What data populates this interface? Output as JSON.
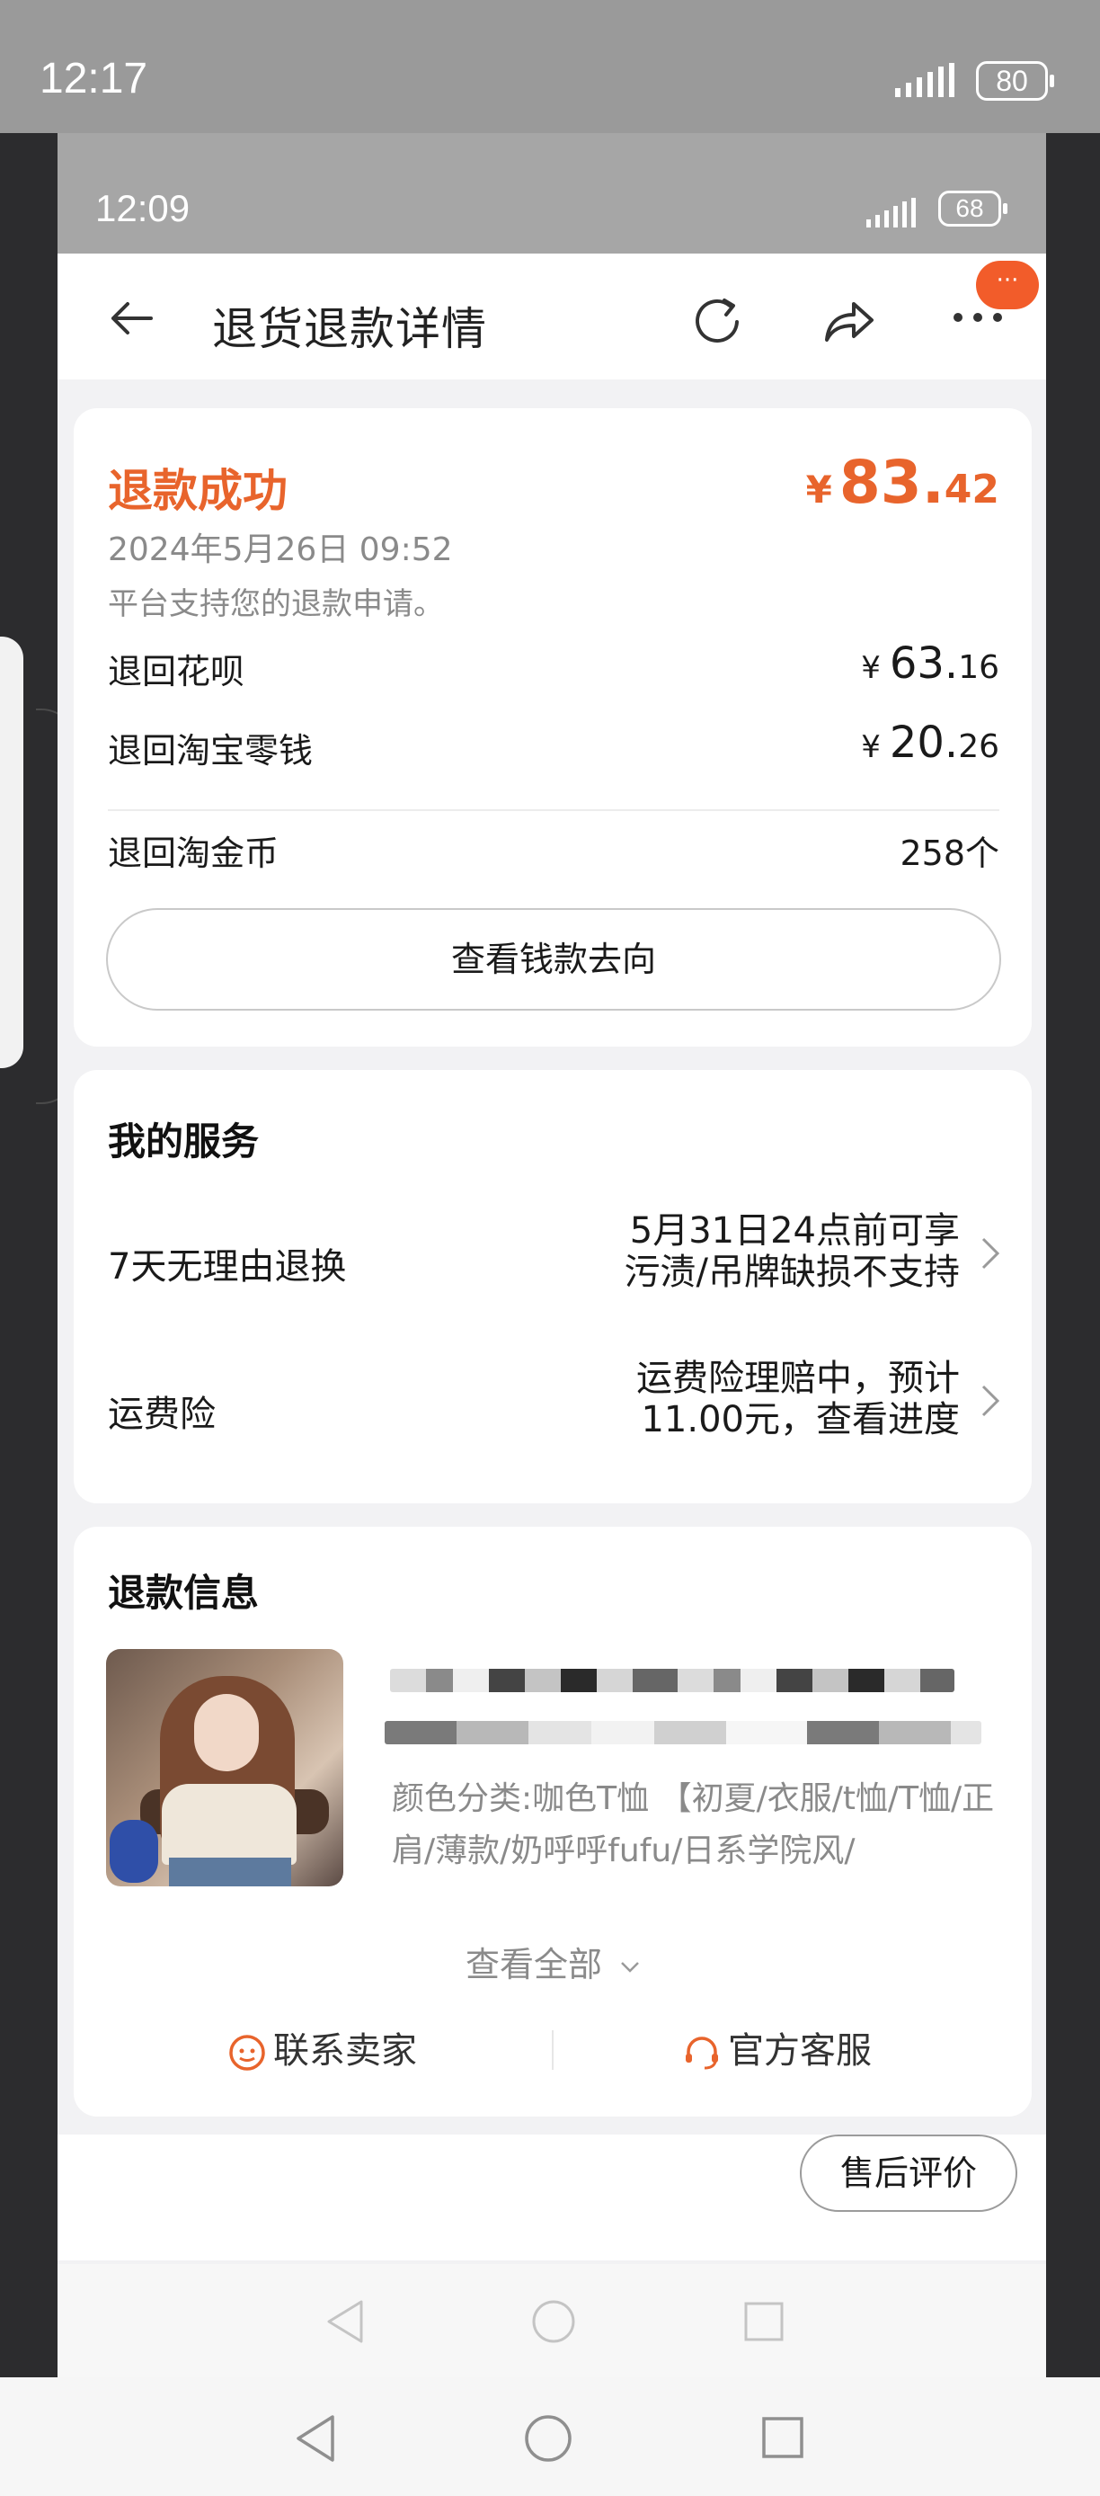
{
  "outer_status": {
    "time": "12:17",
    "battery": "80"
  },
  "inner_status": {
    "time": "12:09",
    "battery": "68"
  },
  "nav": {
    "title": "退货退款详情",
    "badge": "···"
  },
  "refund": {
    "status": "退款成功",
    "currency": "¥",
    "amount_int": "83.",
    "amount_dec": "42",
    "date": "2024年5月26日 09:52",
    "note": "平台支持您的退款申请。",
    "rows": [
      {
        "label": "退回花呗",
        "int": "63.",
        "dec": "16"
      },
      {
        "label": "退回淘宝零钱",
        "int": "20.",
        "dec": "26"
      }
    ],
    "coins_label": "退回淘金币",
    "coins_value": "258个",
    "track_button": "查看钱款去向"
  },
  "services": {
    "title": "我的服务",
    "items": [
      {
        "label": "7天无理由退换",
        "line1": "5月31日24点前可享",
        "line2": "污渍/吊牌缺损不支持"
      },
      {
        "label": "运费险",
        "line1": "运费险理赔中，预计",
        "line2": "11.00元，查看进度"
      }
    ]
  },
  "refund_info": {
    "title": "退款信息",
    "sku": "颜色分类:咖色T恤 【初夏/衣服/t恤/T恤/正肩/薄款/奶呼呼fufu/日系学院风/",
    "see_all": "查看全部",
    "contact_seller": "联系卖家",
    "official_service": "官方客服"
  },
  "bottom": {
    "review_button": "售后评价"
  },
  "colors": {
    "accent": "#e8642c",
    "badge": "#f25c2a",
    "muted": "#8a8a8a"
  }
}
